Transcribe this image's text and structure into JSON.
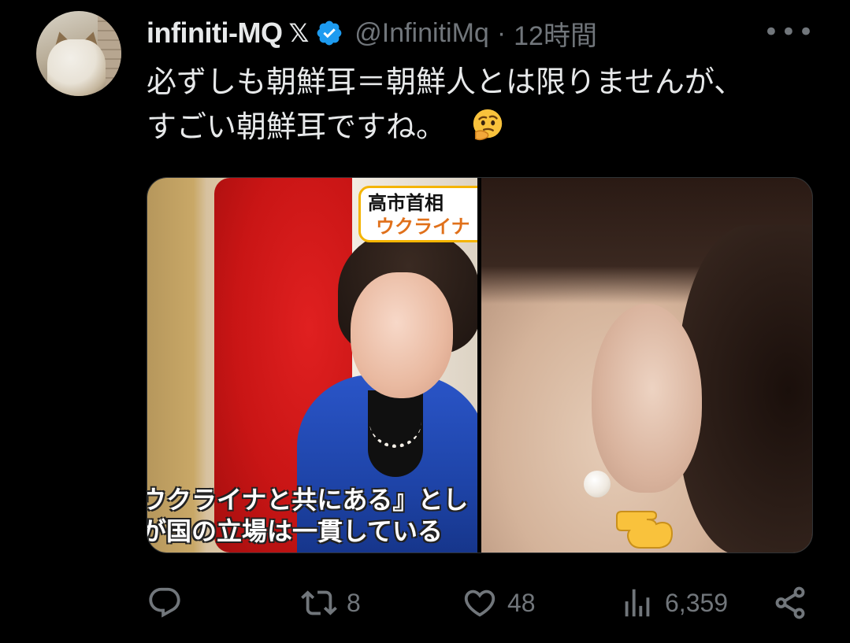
{
  "author": {
    "display_name": "infiniti-MQ",
    "badge_x": "𝕏",
    "handle": "@InfinitiMq",
    "separator": "·",
    "time": "12時間",
    "verified": true,
    "avatar_icon": "cat-avatar"
  },
  "tweet": {
    "text_line1": "必ずしも朝鮮耳＝朝鮮人とは限りませんが、",
    "text_line2": "すごい朝鮮耳ですね。",
    "emoji": "thinking-face"
  },
  "media": {
    "left_image": {
      "caption_top": "高市首相",
      "caption_bottom": "ウクライナ",
      "subtitle_line1": "ウクライナと共にある』とし",
      "subtitle_line2": "が国の立場は一貫している"
    },
    "right_image": {
      "pointer_emoji": "backhand-index-pointing-right"
    }
  },
  "actions": {
    "reply": {
      "icon": "reply-icon",
      "count": ""
    },
    "retweet": {
      "icon": "retweet-icon",
      "count": "8"
    },
    "like": {
      "icon": "heart-icon",
      "count": "48"
    },
    "views": {
      "icon": "views-icon",
      "count": "6,359"
    },
    "share": {
      "icon": "share-icon"
    }
  },
  "more_menu_icon": "more-dots-icon",
  "colors": {
    "background": "#000000",
    "text": "#e7e9ea",
    "muted": "#71767b",
    "verified_blue": "#1d9bf0"
  }
}
